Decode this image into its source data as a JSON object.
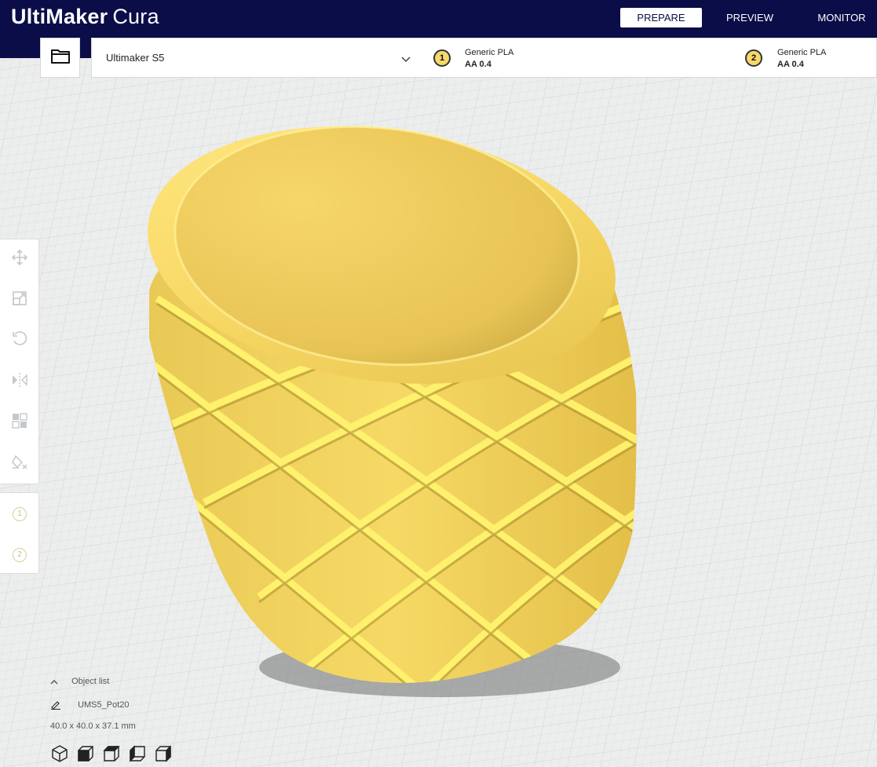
{
  "app": {
    "brand": "UltiMaker",
    "product": "Cura"
  },
  "nav": {
    "tabs": [
      {
        "label": "PREPARE",
        "active": true
      },
      {
        "label": "PREVIEW",
        "active": false
      },
      {
        "label": "MONITOR",
        "active": false
      }
    ]
  },
  "machine": {
    "name": "Ultimaker S5"
  },
  "extruders": [
    {
      "index": "1",
      "material": "Generic PLA",
      "nozzle": "AA 0.4"
    },
    {
      "index": "2",
      "material": "Generic PLA",
      "nozzle": "AA 0.4"
    }
  ],
  "tools": [
    "move-icon",
    "scale-icon",
    "rotate-icon",
    "mirror-icon",
    "per-model-settings-icon",
    "support-blocker-icon"
  ],
  "extruder_tools": [
    "1",
    "2"
  ],
  "object_list": {
    "toggle_label": "Object list",
    "object_name": "UMS5_Pot20",
    "dimensions": "40.0 x 40.0 x 37.1 mm"
  },
  "view_buttons": [
    "3d-view-icon",
    "front-view-icon",
    "top-view-icon",
    "left-view-icon",
    "right-view-icon"
  ],
  "colors": {
    "header": "#0b0d48",
    "model": "#f5d65a",
    "model_highlight": "#fff27a",
    "model_shadow": "#b89a33",
    "extruder_badge": "#f7d86a"
  }
}
